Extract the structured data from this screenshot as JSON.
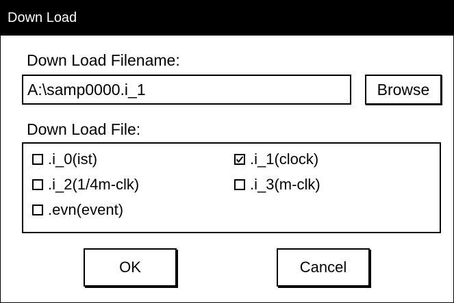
{
  "window": {
    "title": "Down Load"
  },
  "filename": {
    "label": "Down Load Filename:",
    "value": "A:\\samp0000.i_1",
    "browse_label": "Browse"
  },
  "file_group": {
    "label": "Down Load File:",
    "options": [
      {
        "label": ".i_0(ist)",
        "checked": false
      },
      {
        "label": ".i_1(clock)",
        "checked": true
      },
      {
        "label": ".i_2(1/4m-clk)",
        "checked": false
      },
      {
        "label": ".i_3(m-clk)",
        "checked": false
      },
      {
        "label": ".evn(event)",
        "checked": false
      }
    ]
  },
  "buttons": {
    "ok_label": "OK",
    "cancel_label": "Cancel"
  }
}
